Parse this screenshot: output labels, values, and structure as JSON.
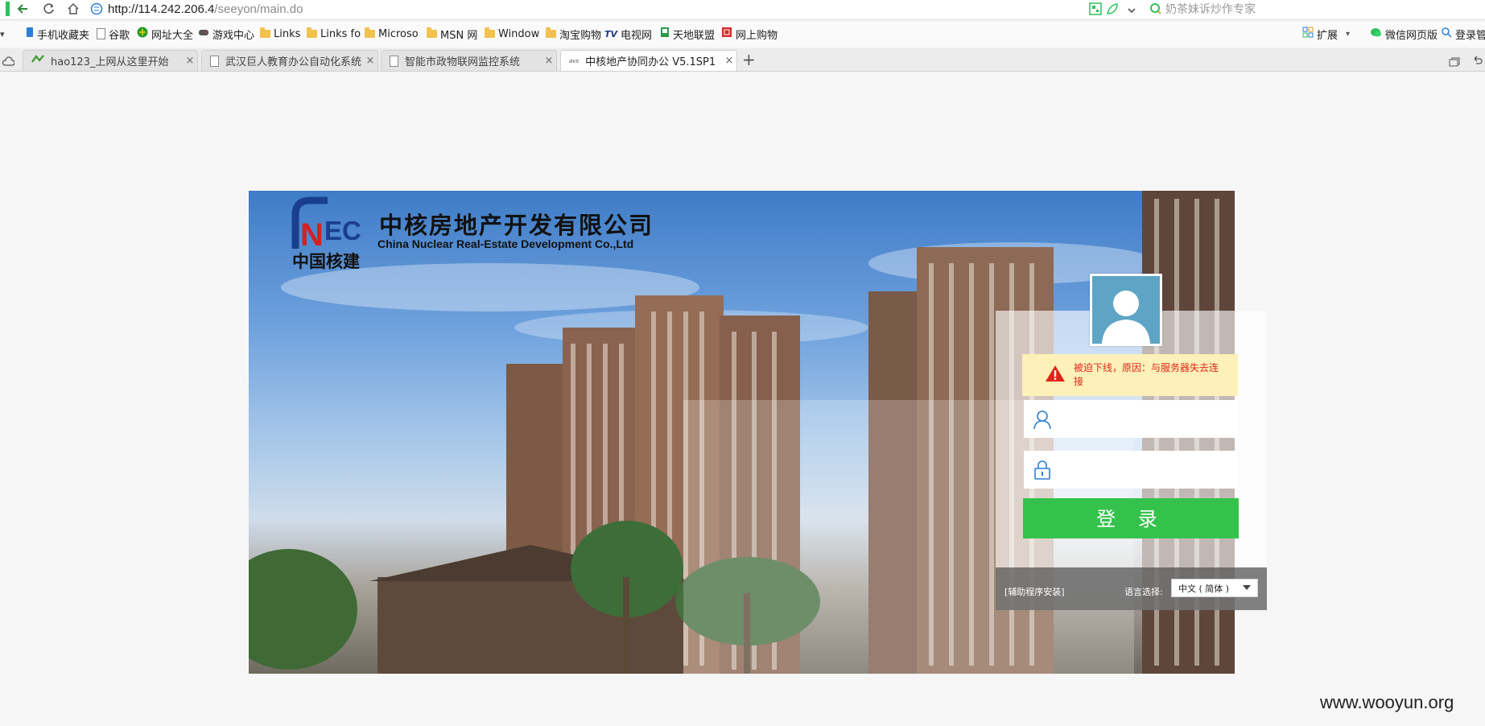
{
  "browser": {
    "url_host": "http://114.242.206.4",
    "url_path": "/seeyon/main.do",
    "search_placeholder": "奶茶妹诉炒作专家",
    "bookmarks": [
      {
        "label": "手机收藏夹",
        "icon": "phone-icon"
      },
      {
        "label": "谷歌",
        "icon": "page-icon"
      },
      {
        "label": "网址大全",
        "icon": "globe-icon"
      },
      {
        "label": "游戏中心",
        "icon": "gamepad-icon"
      },
      {
        "label": "Links",
        "icon": "folder-icon"
      },
      {
        "label": "Links fo",
        "icon": "folder-icon"
      },
      {
        "label": "Microso",
        "icon": "folder-icon"
      },
      {
        "label": "MSN 网",
        "icon": "folder-icon"
      },
      {
        "label": "Window",
        "icon": "folder-icon"
      },
      {
        "label": "淘宝购物",
        "icon": "folder-icon"
      },
      {
        "label": "电视网",
        "icon": "tv-icon"
      },
      {
        "label": "天地联盟",
        "icon": "flag-icon"
      },
      {
        "label": "网上购物",
        "icon": "shop-icon"
      }
    ],
    "toolbar_right": {
      "extensions_label": "扩展",
      "wechat_label": "微信网页版",
      "login_label": "登录管"
    },
    "tabs": [
      {
        "title": "hao123_上网从这里开始",
        "close": "×"
      },
      {
        "title": "武汉巨人教育办公自动化系统",
        "close": "×"
      },
      {
        "title": "智能市政物联网监控系统",
        "close": "×"
      },
      {
        "title": "中核地产协同办公 V5.1SP1",
        "close": "×"
      }
    ],
    "new_tab_label": "+"
  },
  "login": {
    "company_cn": "中核房地产开发有限公司",
    "company_en": "China Nuclear Real-Estate Development Co.,Ltd",
    "logo_text": "NEC",
    "logo_cn": "中国核建",
    "error_message": "被迫下线，原因：与服务器失去连接",
    "username_value": "",
    "password_value": "",
    "login_button": "登 录",
    "helper_link": "[辅助程序安装]",
    "language_label": "语言选择:",
    "language_selected": "中文 ( 简体 )",
    "colors": {
      "accent": "#35c24c",
      "error": "#e0251b",
      "avatar": "#5ea5c5"
    }
  },
  "watermark": "www.wooyun.org"
}
